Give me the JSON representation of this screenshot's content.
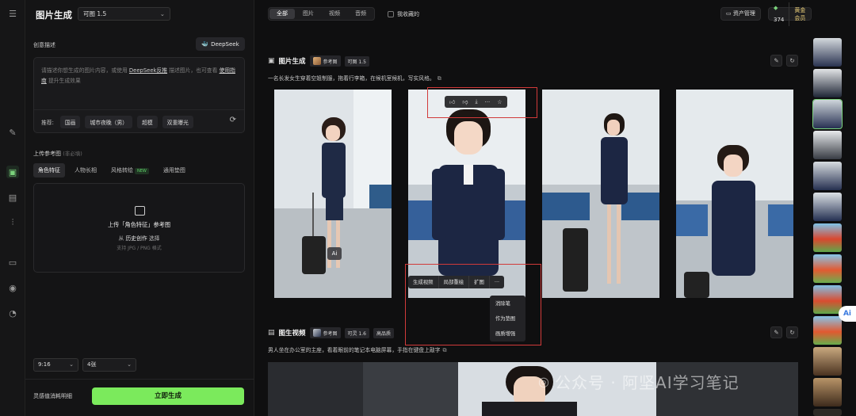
{
  "app": {
    "title": "图片生成",
    "model": "可图 1.5"
  },
  "panel": {
    "creative_desc_label": "创意描述",
    "deepseek_btn": "DeepSeek",
    "desc_placeholder_1": "请描述你想生成的图片内容，或使用",
    "desc_link_deepseek": "DeepSeek反推",
    "desc_placeholder_2": "描述图片，也可查看",
    "desc_link_guide": "使用指南",
    "desc_placeholder_3": "提升生成效果",
    "recommend_label": "推荐:",
    "recommend_chips": [
      "国画",
      "城市夜晚（男）",
      "超模",
      "双重曝光"
    ],
    "upload_ref_label": "上传参考图",
    "upload_ref_hint": "(非必填)",
    "ref_tabs": [
      "角色特征",
      "人物长相",
      "风格转绘",
      "通用垫图"
    ],
    "new_badge": "NEW",
    "upload_title": "上传「角色特征」参考图",
    "upload_from_prefix": "从",
    "upload_from_link": "历史创作",
    "upload_from_suffix": "选择",
    "upload_formats": "支持 JPG / PNG 格式",
    "ratio": "9:16",
    "count": "4张",
    "consume_label": "灵感值消耗明细",
    "generate_btn": "立即生成"
  },
  "toolbar": {
    "tabs": [
      "全部",
      "图片",
      "视频",
      "音频"
    ],
    "favorites": "我收藏的",
    "asset_mgmt": "资产管理",
    "points": "374",
    "membership": "黄金会员"
  },
  "image_card": {
    "title": "图片生成",
    "ref_tag": "参考图",
    "model_tag": "可图 1.5",
    "prompt": "一名长发女生穿着空姐制服，拖着行李箱，在候机室候机，写实风格。",
    "ai_badge": "Ai",
    "actions": [
      "生成视频",
      "局部重绘",
      "扩图",
      "···"
    ],
    "menu_items": [
      "消除笔",
      "作为垫图",
      "画质增强"
    ]
  },
  "video_card": {
    "title": "图生视频",
    "ref_tag": "参考图",
    "model_tag": "可灵 1.6",
    "quality_tag": "高品质",
    "prompt": "男人坐在办公室的主座，看着眼前的笔记本电脑屏幕，手指在键盘上敲字"
  },
  "watermark": "公众号 · 阿坚AI学习笔记",
  "ai_float": "Ai",
  "colors": {
    "accent_green": "#7bea5c",
    "highlight_red": "#d13a3a",
    "gold": "#f0d37a"
  }
}
